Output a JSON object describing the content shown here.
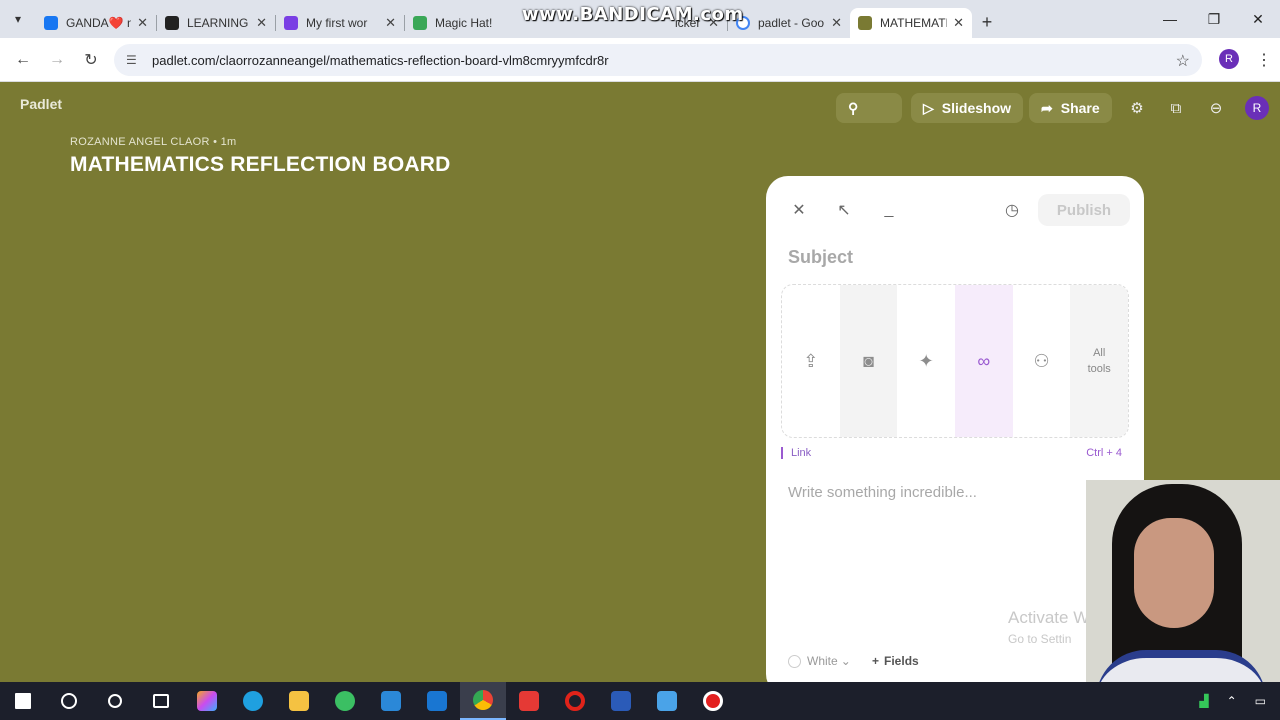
{
  "browser": {
    "tabs": [
      {
        "title": "GANDA❤️ n",
        "color": "#1877f2",
        "active": false
      },
      {
        "title": "LEARNING C",
        "color": "#222222",
        "active": false
      },
      {
        "title": "My first wor",
        "color": "#7a3fe4",
        "active": false
      },
      {
        "title": "Magic Hat!",
        "color": "#3aa757",
        "active": false
      },
      {
        "title": "icker",
        "color": "#999999",
        "active": false
      },
      {
        "title": "padlet - Goo",
        "color": "#4285f4",
        "active": false
      },
      {
        "title": "MATHEMATI",
        "color": "#7a7a33",
        "active": true
      }
    ],
    "watermark": "www.BANDICAM.com",
    "url": "padlet.com/claorrozanneangel/mathematics-reflection-board-vlm8cmryymfcdr8r",
    "profile_initial": "R"
  },
  "padlet": {
    "logo": "Padlet",
    "slideshow_label": "Slideshow",
    "share_label": "Share",
    "avatar_initial": "R",
    "author_line": "ROZANNE ANGEL CLAOR • 1m",
    "board_title": "MATHEMATICS REFLECTION BOARD"
  },
  "composer": {
    "publish_label": "Publish",
    "subject_placeholder": "Subject",
    "tools": [
      {
        "icon": "upload-icon"
      },
      {
        "icon": "camera-icon"
      },
      {
        "icon": "magic-image-icon"
      },
      {
        "icon": "link-icon",
        "active": true
      },
      {
        "icon": "image-search-icon"
      },
      {
        "label_line1": "All",
        "label_line2": "tools"
      }
    ],
    "selected_tool_label": "Link",
    "selected_tool_shortcut": "Ctrl + 4",
    "body_placeholder": "Write something incredible...",
    "color_label": "White",
    "fields_label": "Fields",
    "activate_line1": "Activate W",
    "activate_line2": "Go to Settin"
  },
  "colors": {
    "board_bg": "#7a7a33",
    "accent": "#9a5ad0",
    "avatar": "#6a2fb8"
  }
}
